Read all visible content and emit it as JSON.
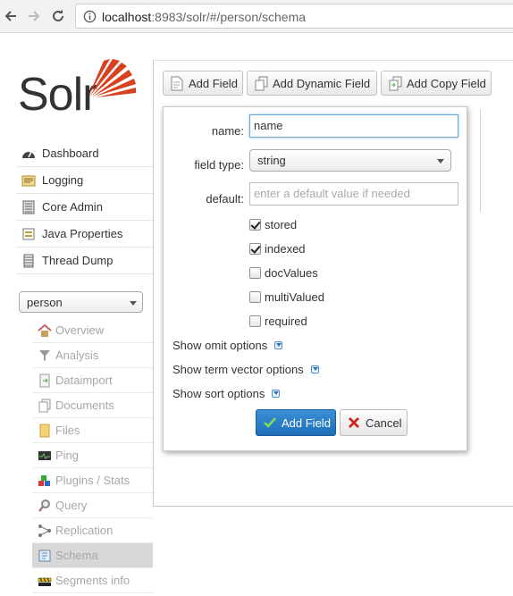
{
  "browser": {
    "url_host": "localhost",
    "url_rest": ":8983/solr/#/person/schema"
  },
  "logo": {
    "text": "Solr"
  },
  "main_nav": [
    {
      "label": "Dashboard",
      "icon": "dashboard-icon"
    },
    {
      "label": "Logging",
      "icon": "logging-icon"
    },
    {
      "label": "Core Admin",
      "icon": "core-admin-icon"
    },
    {
      "label": "Java Properties",
      "icon": "java-properties-icon"
    },
    {
      "label": "Thread Dump",
      "icon": "thread-dump-icon"
    }
  ],
  "core_selector": {
    "value": "person"
  },
  "core_nav": [
    {
      "label": "Overview",
      "icon": "overview-icon"
    },
    {
      "label": "Analysis",
      "icon": "analysis-icon"
    },
    {
      "label": "Dataimport",
      "icon": "dataimport-icon"
    },
    {
      "label": "Documents",
      "icon": "documents-icon"
    },
    {
      "label": "Files",
      "icon": "files-icon"
    },
    {
      "label": "Ping",
      "icon": "ping-icon"
    },
    {
      "label": "Plugins / Stats",
      "icon": "plugins-icon"
    },
    {
      "label": "Query",
      "icon": "query-icon"
    },
    {
      "label": "Replication",
      "icon": "replication-icon"
    },
    {
      "label": "Schema",
      "icon": "schema-icon"
    },
    {
      "label": "Segments info",
      "icon": "segments-icon"
    }
  ],
  "toolbar": {
    "add_field": "Add Field",
    "add_dynamic_field": "Add Dynamic Field",
    "add_copy_field": "Add Copy Field"
  },
  "dialog": {
    "name_label": "name:",
    "name_value": "name",
    "field_type_label": "field type:",
    "field_type_value": "string",
    "default_label": "default:",
    "default_placeholder": "enter a default value if needed",
    "checkboxes": [
      {
        "label": "stored",
        "checked": true
      },
      {
        "label": "indexed",
        "checked": true
      },
      {
        "label": "docValues",
        "checked": false
      },
      {
        "label": "multiValued",
        "checked": false
      },
      {
        "label": "required",
        "checked": false
      }
    ],
    "show_omit": "Show omit options",
    "show_term_vector": "Show term vector options",
    "show_sort": "Show sort options",
    "submit_label": "Add Field",
    "cancel_label": "Cancel"
  }
}
